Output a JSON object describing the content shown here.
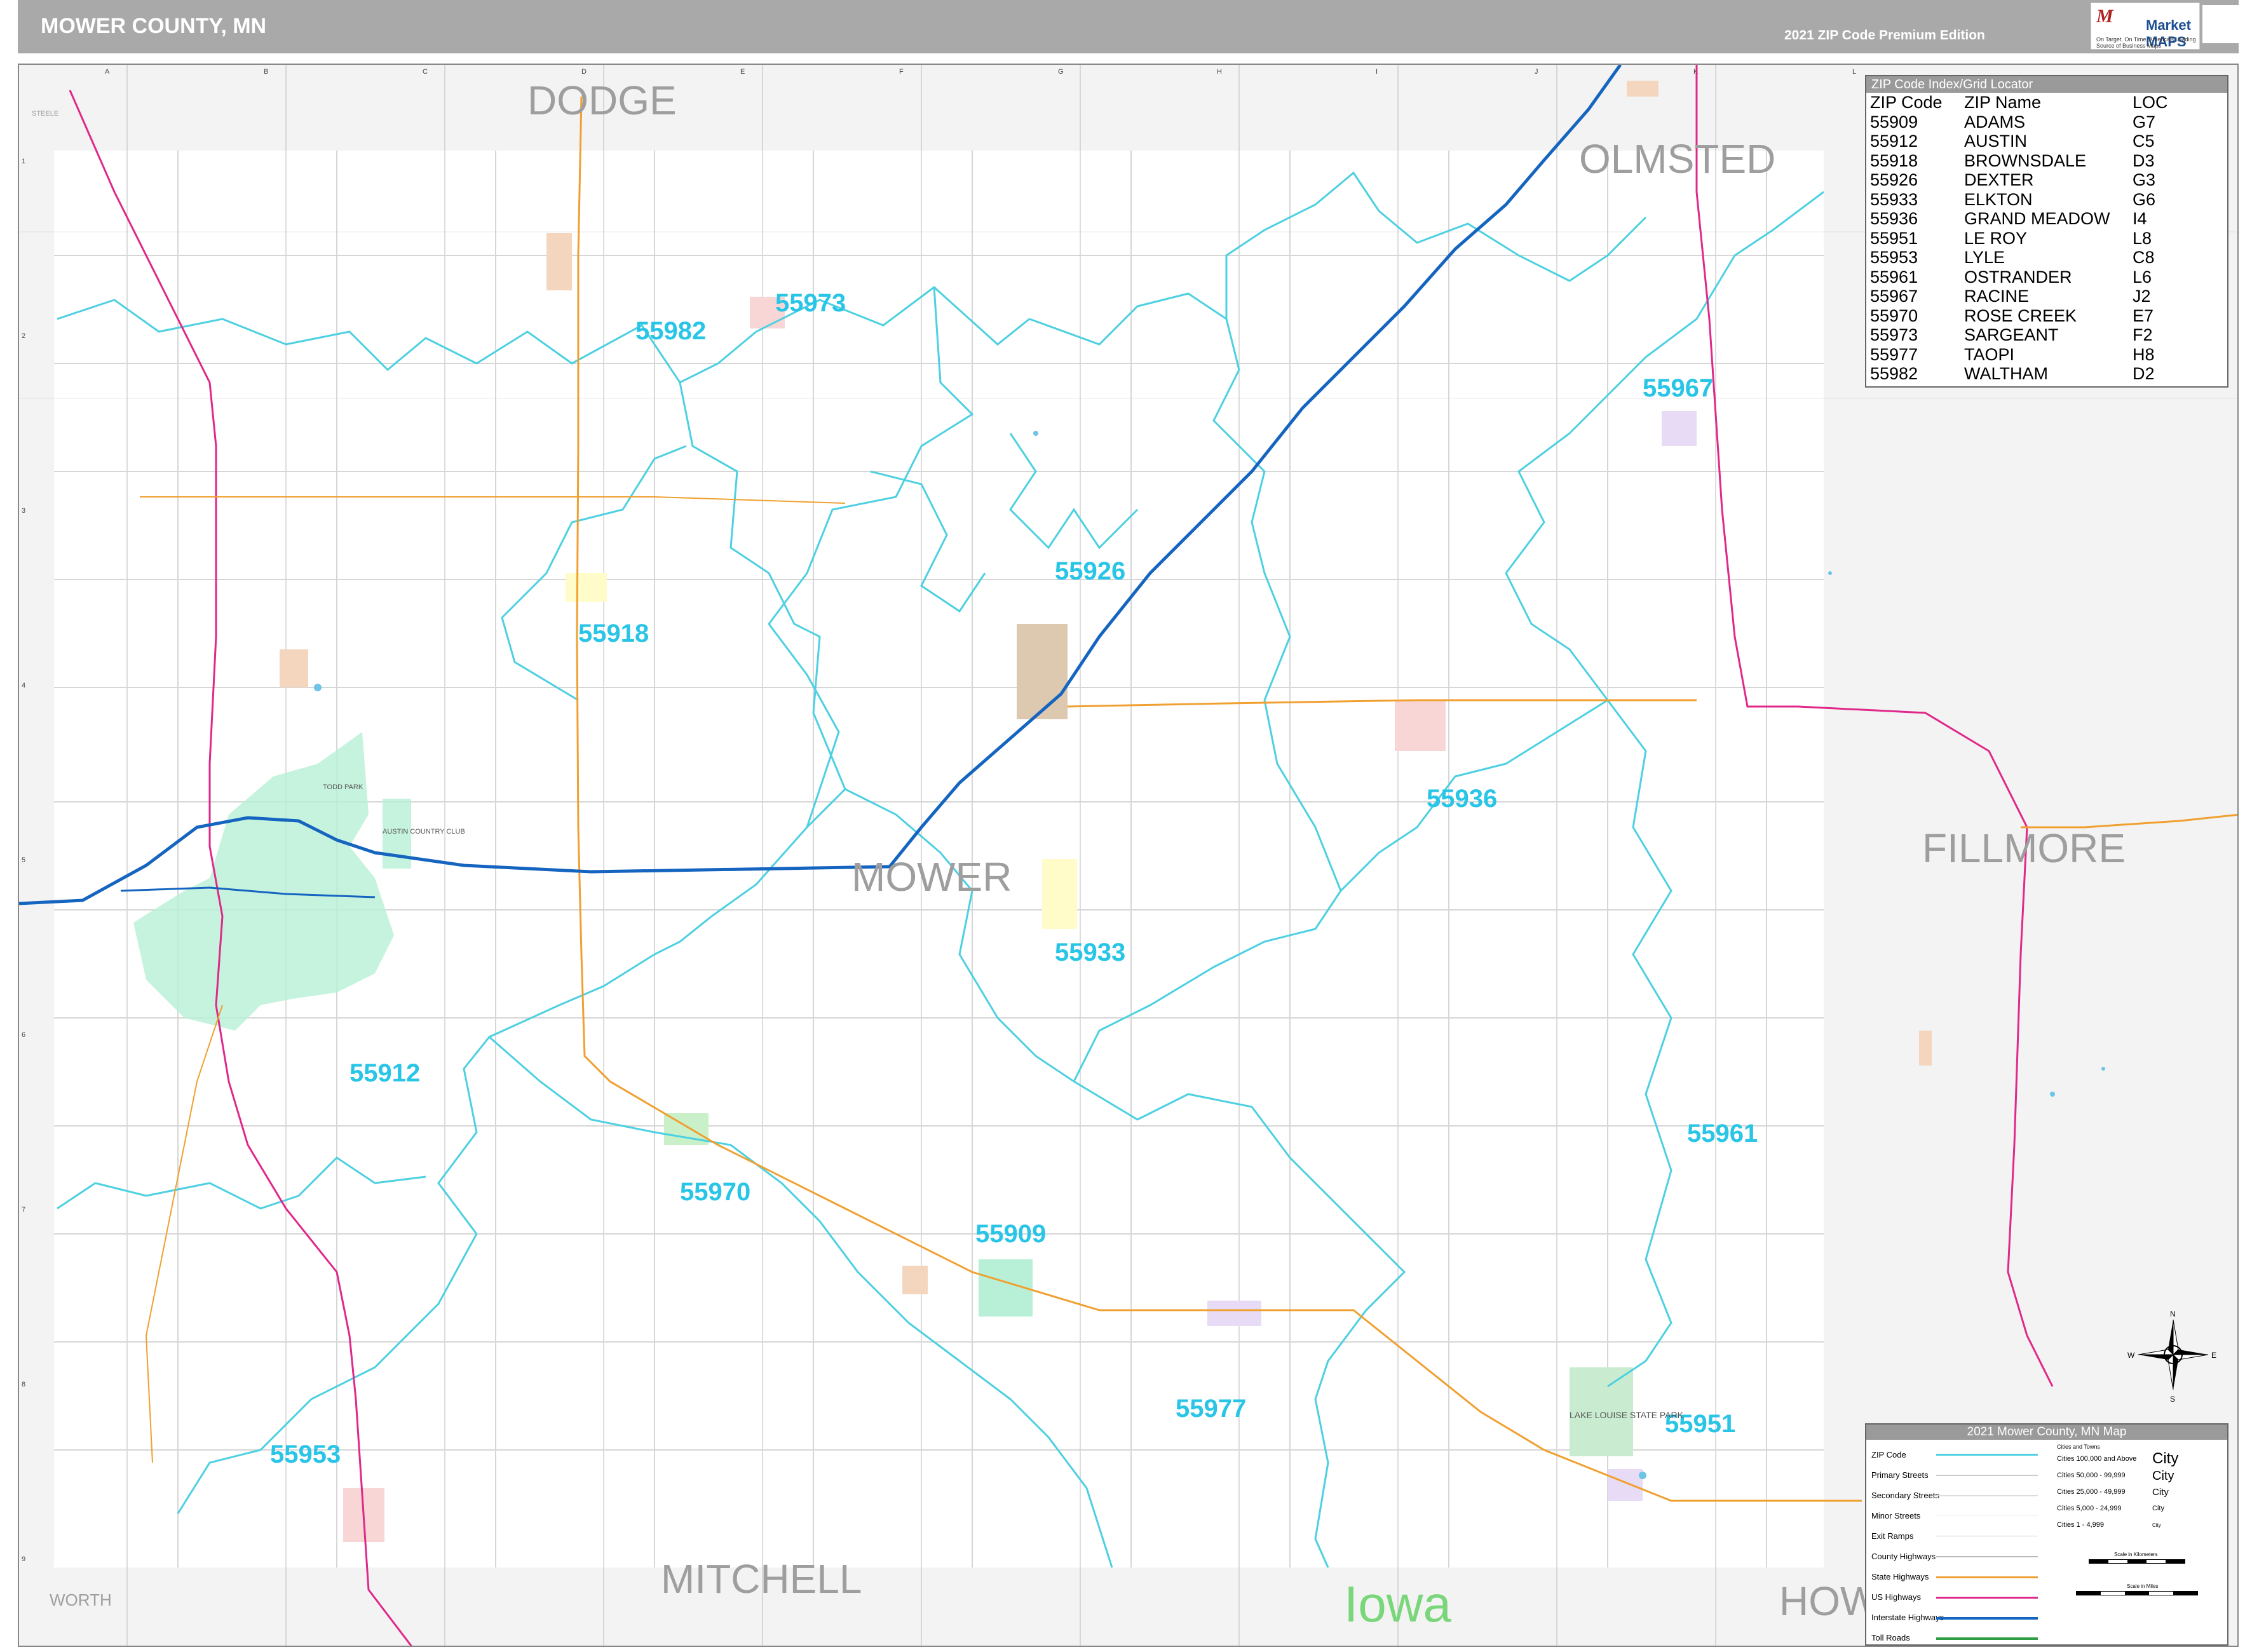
{
  "header": {
    "title": "MOWER COUNTY, MN",
    "edition": "2021 ZIP Code Premium Edition",
    "logo_text": "Market MAPS",
    "logo_tagline": "On Target. On Time. America's Leading Source of Business Maps"
  },
  "grid": {
    "columns": [
      "A",
      "B",
      "C",
      "D",
      "E",
      "F",
      "G",
      "H",
      "I",
      "J",
      "K",
      "L"
    ],
    "rows": [
      "1",
      "2",
      "3",
      "4",
      "5",
      "6",
      "7",
      "8",
      "9"
    ]
  },
  "neighbors": {
    "dodge": "DODGE",
    "olmsted": "OLMSTED",
    "fillmore": "FILLMORE",
    "mitchell": "MITCHELL",
    "worth": "WORTH",
    "iowa": "Iowa",
    "howard": "HOW",
    "steele": "STEELE"
  },
  "county_label": "MOWER",
  "zip_labels": [
    "55973",
    "55982",
    "55967",
    "55926",
    "55918",
    "55936",
    "55933",
    "55912",
    "55961",
    "55970",
    "55909",
    "55977",
    "55951",
    "55953"
  ],
  "places": {
    "todd_park": "TODD PARK",
    "country_club": "AUSTIN COUNTRY CLUB",
    "lake_louise": "LAKE LOUISE STATE PARK"
  },
  "zip_index": {
    "header": "ZIP Code Index/Grid Locator",
    "columns": [
      "ZIP Code",
      "ZIP Name",
      "LOC"
    ],
    "rows": [
      [
        "55909",
        "ADAMS",
        "G7"
      ],
      [
        "55912",
        "AUSTIN",
        "C5"
      ],
      [
        "55918",
        "BROWNSDALE",
        "D3"
      ],
      [
        "55926",
        "DEXTER",
        "G3"
      ],
      [
        "55933",
        "ELKTON",
        "G6"
      ],
      [
        "55936",
        "GRAND MEADOW",
        "I4"
      ],
      [
        "55951",
        "LE ROY",
        "L8"
      ],
      [
        "55953",
        "LYLE",
        "C8"
      ],
      [
        "55961",
        "OSTRANDER",
        "L6"
      ],
      [
        "55967",
        "RACINE",
        "J2"
      ],
      [
        "55970",
        "ROSE CREEK",
        "E7"
      ],
      [
        "55973",
        "SARGEANT",
        "F2"
      ],
      [
        "55977",
        "TAOPI",
        "H8"
      ],
      [
        "55982",
        "WALTHAM",
        "D2"
      ]
    ]
  },
  "legend": {
    "header": "2021 Mower County, MN Map",
    "items": [
      "ZIP Code",
      "Primary Streets",
      "Secondary Streets",
      "Minor Streets",
      "Exit Ramps",
      "County Highways",
      "State Highways",
      "US Highways",
      "Interstate Highways",
      "Toll Roads"
    ],
    "cities_header": "Cities and Towns",
    "cities": [
      "Cities 100,000 and Above",
      "Cities 50,000 - 99,999",
      "Cities 25,000 - 49,999",
      "Cities 5,000 - 24,999",
      "Cities 1 - 4,999"
    ],
    "city_symbols": [
      "City",
      "City",
      "City",
      "City",
      "City"
    ],
    "scale_km": "Scale in Kilometers",
    "scale_mi": "Scale in Miles"
  },
  "compass": {
    "n": "N",
    "s": "S",
    "e": "E",
    "w": "W"
  },
  "colors": {
    "zip_boundary": "#4dd0e1",
    "zip_label": "#29c5e6",
    "interstate": "#1565c0",
    "us_highway": "#e0288a",
    "state_highway": "#f0a030",
    "neighbor_text": "#9e9e9e",
    "iowa_text": "#7ad67a"
  }
}
